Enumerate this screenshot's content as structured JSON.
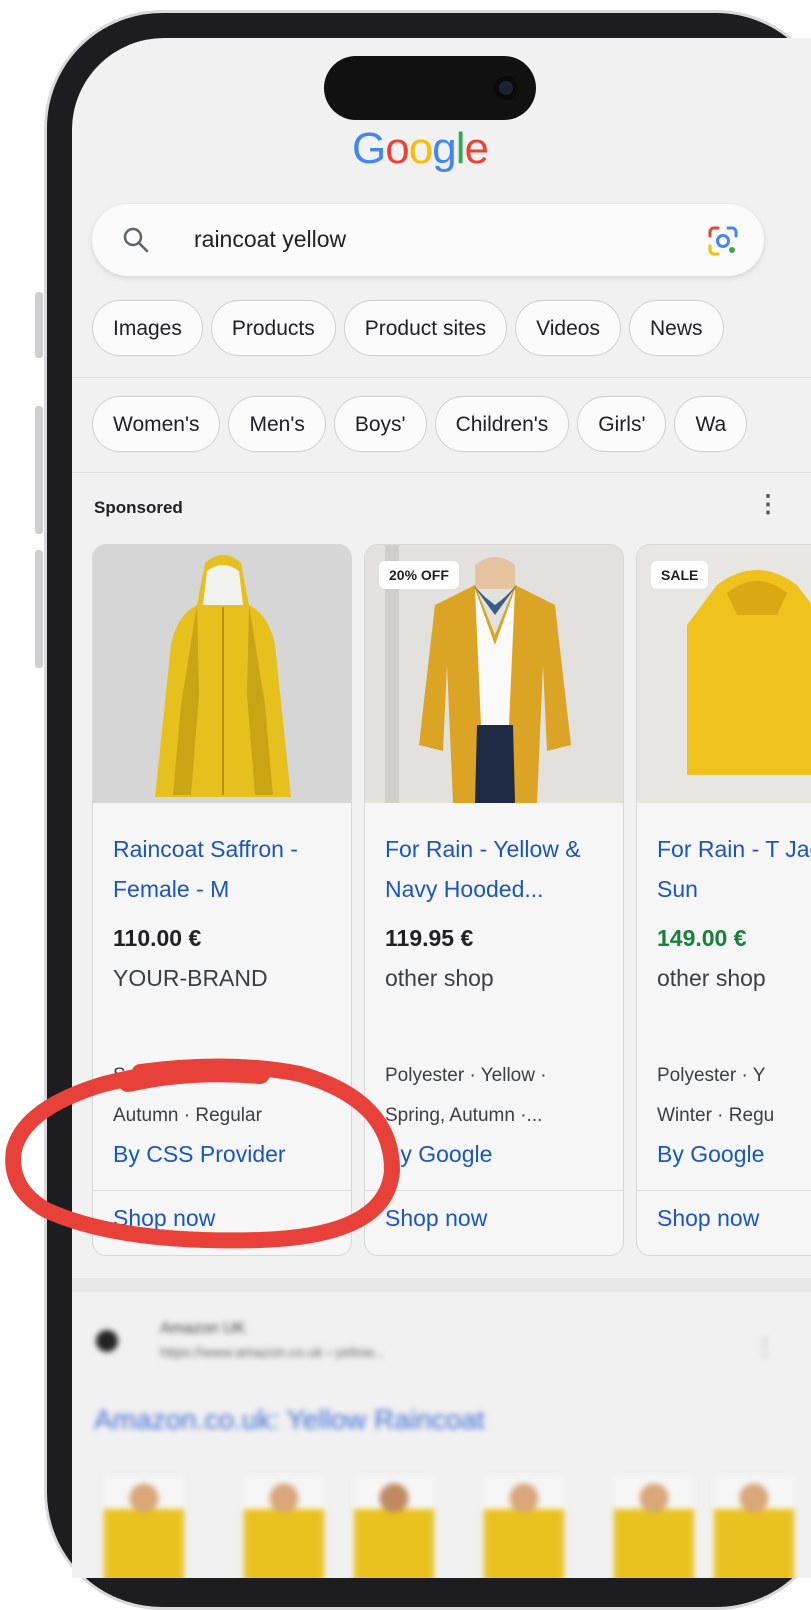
{
  "search": {
    "query": "raincoat yellow"
  },
  "logo": {
    "letters": [
      "G",
      "o",
      "o",
      "g",
      "l",
      "e"
    ]
  },
  "filters": [
    "Images",
    "Products",
    "Product sites",
    "Videos",
    "News"
  ],
  "categories": [
    "Women's",
    "Men's",
    "Boys'",
    "Children's",
    "Girls'",
    "Wa"
  ],
  "section": {
    "label": "Sponsored",
    "more": "⋮"
  },
  "products": [
    {
      "badge": "",
      "title": "Raincoat Saffron - Female - M",
      "price": "110.00 €",
      "price_color": "#202124",
      "shop": "YOUR-BRAND",
      "attr1": "S",
      "attr2": "Autumn · Regular",
      "by": "By CSS Provider",
      "cta": "Shop now"
    },
    {
      "badge": "20% OFF",
      "title": "For Rain - Yellow & Navy Hooded...",
      "price": "119.95 €",
      "price_color": "#202124",
      "shop": "other shop",
      "attr1": "Polyester · Yellow ·",
      "attr2": "Spring, Autumn ·...",
      "by": "By Google",
      "cta": "Shop now"
    },
    {
      "badge": "SALE",
      "title": "For Rain - T Jacket Sun",
      "price": "149.00 €",
      "price_color": "#188038",
      "shop": "other shop",
      "attr1": "Polyester · Y",
      "attr2": "Winter · Regu",
      "by": "By Google",
      "cta": "Shop now"
    }
  ],
  "organic": {
    "site": "Amazon UK",
    "url": "https://www.amazon.co.uk › yellow...",
    "title": "Amazon.co.uk: Yellow Raincoat",
    "more": "⋮"
  },
  "colors": {
    "link": "#1a55c5",
    "annotation": "#e8413a",
    "coat_yellow": "#e4be1f"
  }
}
